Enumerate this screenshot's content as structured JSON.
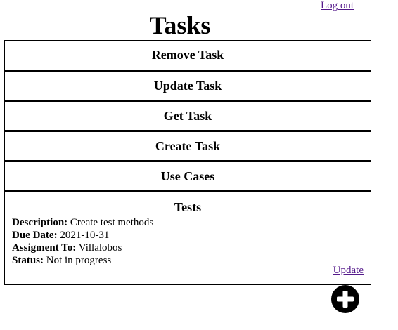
{
  "header": {
    "logout_label": "Log out",
    "title": "Tasks"
  },
  "tasks": [
    {
      "name": "Remove Task"
    },
    {
      "name": "Update Task"
    },
    {
      "name": "Get Task"
    },
    {
      "name": "Create Task"
    },
    {
      "name": "Use Cases"
    }
  ],
  "selected_task": {
    "name": "Tests",
    "description_label": "Description:",
    "description": "Create test methods",
    "due_date_label": "Due Date:",
    "due_date": "2021-10-31",
    "assigned_label": "Assigment To:",
    "assigned_to": "Villalobos",
    "status_label": "Status:",
    "status": "Not in progress",
    "update_label": "Update"
  },
  "add_button": {
    "icon": "plus-circle-icon",
    "color": "#000000"
  }
}
